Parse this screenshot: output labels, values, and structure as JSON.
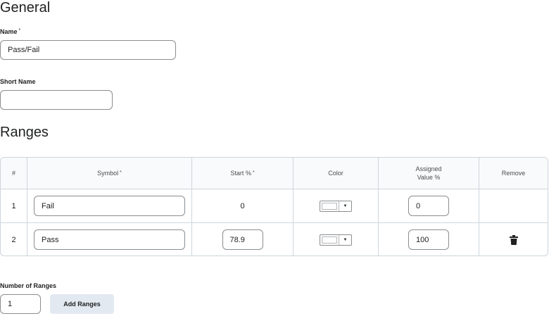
{
  "general": {
    "heading": "General",
    "name_label": "Name",
    "name_required": "*",
    "name_value": "Pass/Fail",
    "short_name_label": "Short Name",
    "short_name_value": ""
  },
  "ranges": {
    "heading": "Ranges",
    "columns": {
      "number": "#",
      "symbol": "Symbol",
      "symbol_required": "*",
      "start": "Start %",
      "start_required": "*",
      "color": "Color",
      "assigned_line1": "Assigned",
      "assigned_line2": "Value %",
      "remove": "Remove"
    },
    "rows": [
      {
        "number": "1",
        "symbol": "Fail",
        "start": "0",
        "color": "#ffffff",
        "assigned": "0",
        "removable": false
      },
      {
        "number": "2",
        "symbol": "Pass",
        "start": "78.9",
        "color": "#ffffff",
        "assigned": "100",
        "removable": true,
        "remove_icon": "trash-icon"
      }
    ]
  },
  "add": {
    "number_label": "Number of Ranges",
    "number_value": "1",
    "button_label": "Add Ranges"
  }
}
